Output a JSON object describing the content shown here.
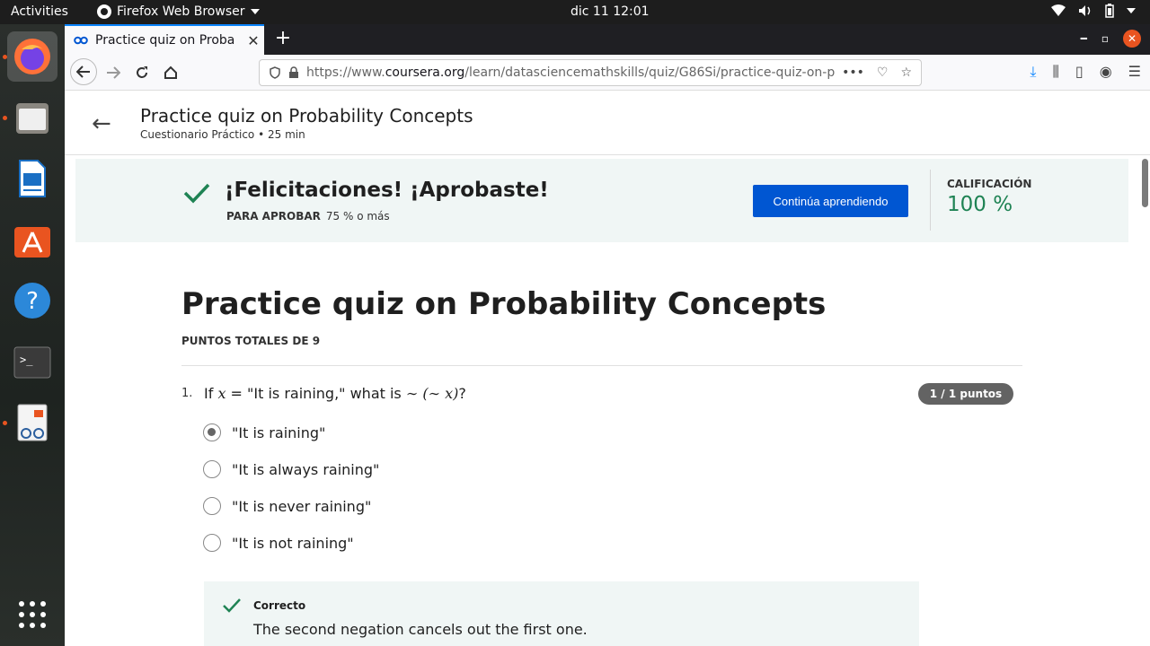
{
  "system": {
    "activities": "Activities",
    "app_name": "Firefox Web Browser",
    "clock": "dic 11  12:01"
  },
  "browser": {
    "tab_title": "Practice quiz on Probabil",
    "url_prefix": "https://www.",
    "url_domain": "coursera.org",
    "url_path": "/learn/datasciencemathskills/quiz/G86Si/practice-quiz-on-p"
  },
  "header": {
    "title": "Practice quiz on Probability Concepts",
    "subtitle": "Cuestionario Práctico • 25 min"
  },
  "banner": {
    "headline": "¡Felicitaciones! ¡Aprobaste!",
    "pass_label": "PARA APROBAR",
    "pass_value": "75 % o más",
    "cta_label": "Continúa aprendiendo",
    "grade_label": "CALIFICACIÓN",
    "grade_value": "100 %",
    "accent": "#0056d2",
    "success": "#1f8354"
  },
  "quiz": {
    "title": "Practice quiz on Probability Concepts",
    "total": "PUNTOS TOTALES DE 9",
    "question": {
      "number": "1.",
      "prefix": "If ",
      "var": "x",
      "mid": " = \"It is raining,\" what is ",
      "expr": "∼ (∼ x)",
      "suffix": "?",
      "points": "1 / 1 puntos",
      "options": [
        {
          "label": "\"It is raining\"",
          "selected": true
        },
        {
          "label": "\"It is always raining\"",
          "selected": false
        },
        {
          "label": "\"It is never raining\"",
          "selected": false
        },
        {
          "label": "\"It is not raining\"",
          "selected": false
        }
      ],
      "feedback_label": "Correcto",
      "feedback_text": "The second negation cancels out the first one."
    }
  }
}
